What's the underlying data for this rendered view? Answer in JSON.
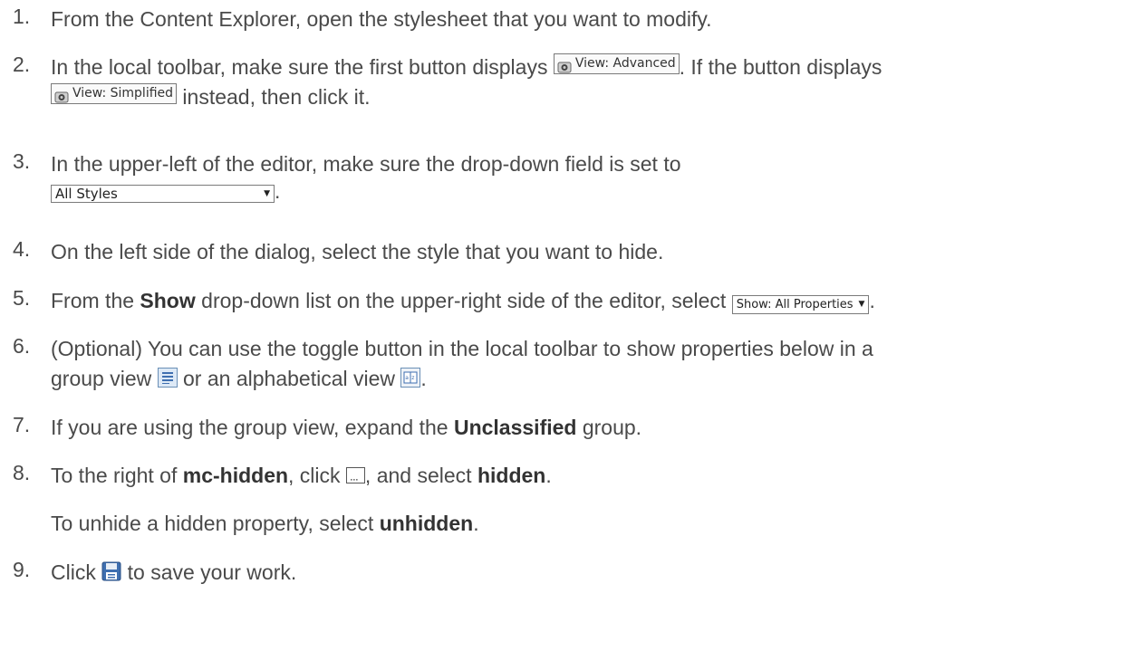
{
  "steps": [
    {
      "num": "1.",
      "text": "From the Content Explorer, open the stylesheet that you want to modify."
    },
    {
      "num": "2.",
      "text_a": "In the local toolbar, make sure the first button displays",
      "button_advanced": "View: Advanced",
      "text_b": ". If the button displays",
      "button_simplified": "View: Simplified",
      "text_c": "instead, then click it."
    },
    {
      "num": "3.",
      "text_a": "In the upper-left of the editor, make sure the drop-down field is set to",
      "select_value": "All Styles",
      "text_b": "."
    },
    {
      "num": "4.",
      "text": "On the left side of the dialog, select the style that you want to hide."
    },
    {
      "num": "5.",
      "text_a": "From the",
      "bold": "Show",
      "text_b": "drop-down list on the upper-right side of the editor, select",
      "select_value": "Show: All Properties",
      "text_c": "."
    },
    {
      "num": "6.",
      "text_a": "(Optional) You can use the toggle button in the local toolbar to show properties below in a",
      "text_b": "group view",
      "text_c": "or an alphabetical view",
      "text_d": "."
    },
    {
      "num": "7.",
      "text_a": "If you are using the group view, expand the",
      "bold": "Unclassified",
      "text_b": "group."
    },
    {
      "num": "8.",
      "text_a": "To the right of",
      "bold_a": "mc-hidden",
      "text_b": ", click",
      "text_c": ", and select",
      "bold_b": "hidden",
      "text_d": ".",
      "sub_a": "To unhide a hidden property, select",
      "sub_bold": "unhidden",
      "sub_b": "."
    },
    {
      "num": "9.",
      "text_a": "Click",
      "text_b": "to save your work."
    }
  ],
  "icons": {
    "view_button": "eye-camera-icon",
    "group_view": "group-view-icon",
    "alphabetical_view": "alphabetical-view-icon",
    "ellipsis": "ellipsis-button-icon",
    "save": "save-disk-icon"
  },
  "colors": {
    "text": "#4a4a4a",
    "bold": "#333333",
    "icon_blue": "#3f6fb0"
  }
}
